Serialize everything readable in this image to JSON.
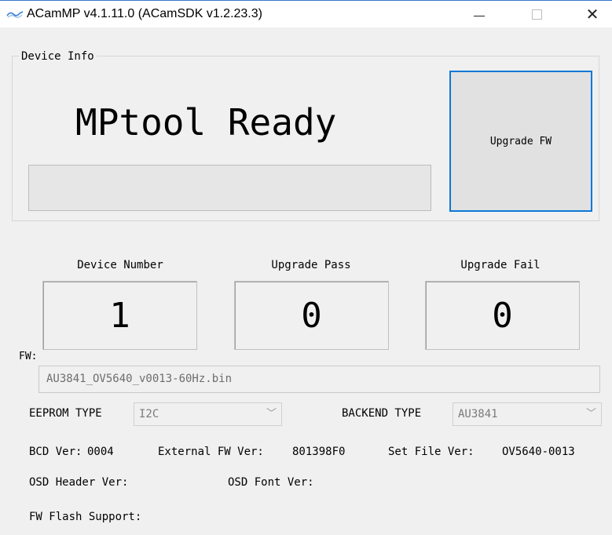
{
  "window": {
    "title": "ACamMP v4.1.11.0 (ACamSDK v1.2.23.3)",
    "minimize_glyph": "—",
    "close_glyph": "✕"
  },
  "device_info": {
    "legend": "Device Info",
    "status": "MPtool Ready",
    "progress": 0,
    "upgrade_button": "Upgrade FW"
  },
  "counters": [
    {
      "label": "Device Number",
      "value": "1"
    },
    {
      "label": "Upgrade Pass",
      "value": "0"
    },
    {
      "label": "Upgrade Fail",
      "value": "0"
    }
  ],
  "fw": {
    "label": "FW:",
    "file": "AU3841_OV5640_v0013-60Hz.bin"
  },
  "eeprom": {
    "label": "EEPROM TYPE",
    "value": "I2C"
  },
  "backend": {
    "label": "BACKEND TYPE",
    "value": "AU3841"
  },
  "versions": {
    "bcd_label": "BCD Ver:",
    "bcd_value": "0004",
    "ext_fw_label": "External FW Ver:",
    "ext_fw_value": "801398F0",
    "set_file_label": "Set File Ver:",
    "set_file_value": "OV5640-0013",
    "osd_header_label": "OSD Header Ver:",
    "osd_font_label": "OSD Font Ver:",
    "fw_flash_label": "FW Flash Support:"
  },
  "colors": {
    "accent": "#0a78d7",
    "window_bg": "#f0f0f0",
    "disabled_text": "#7a7a7a"
  }
}
